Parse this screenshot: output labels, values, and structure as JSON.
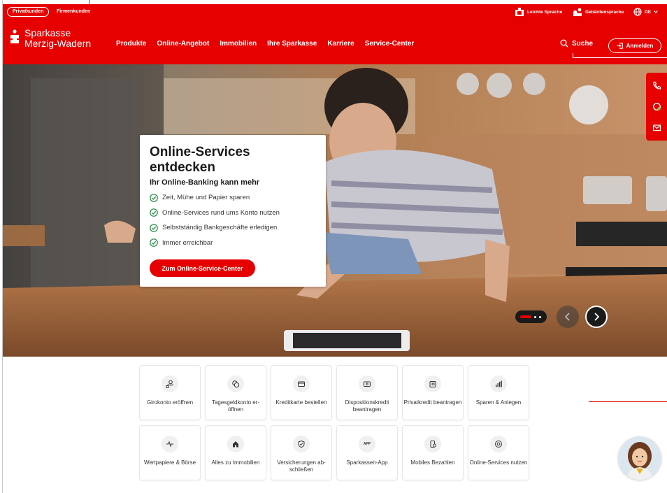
{
  "header": {
    "segment_private": "Privatkunden",
    "segment_business": "Firmenkunden",
    "easy_language": "Leichte Sprache",
    "sign_language": "Gebärdensprache",
    "language": "DE",
    "bank_name_line1": "Sparkasse",
    "bank_name_line2": "Merzig-Wadern",
    "nav": [
      "Produkte",
      "Online-Angebot",
      "Immobilien",
      "Ihre Sparkasse",
      "Karriere",
      "Service-Center"
    ],
    "search_label": "Suche",
    "login_label": "Anmelden"
  },
  "hero": {
    "title": "Online-Services entdecken",
    "subtitle": "Ihr Online-Banking kann mehr",
    "bullets": [
      "Zeit, Mühe und Papier sparen",
      "Online-Services rund ums Konto nutzen",
      "Selbstständig Bankgeschäfte erledigen",
      "Immer erreichbar"
    ],
    "cta": "Zum Online-Service-Center"
  },
  "tiles": [
    {
      "label": "Girokonto eröffnen",
      "icon": "hand-coin-icon"
    },
    {
      "label": "Tagesgeldkonto er­öffnen",
      "icon": "coins-icon"
    },
    {
      "label": "Kreditkarte bestel­len",
      "icon": "credit-card-icon"
    },
    {
      "label": "Dispositionskredit beantragen",
      "icon": "banknote-icon"
    },
    {
      "label": "Privatkredit bean­tragen",
      "icon": "wallet-icon"
    },
    {
      "label": "Sparen & Anlegen",
      "icon": "bar-chart-icon"
    },
    {
      "label": "Wertpapiere & Bör­se",
      "icon": "stock-pulse-icon"
    },
    {
      "label": "Alles zu Immobili­en",
      "icon": "house-icon"
    },
    {
      "label": "Versicherungen ab­schließen",
      "icon": "shield-icon"
    },
    {
      "label": "Sparkassen-App",
      "icon": "app-icon"
    },
    {
      "label": "Mobiles Bezahlen",
      "icon": "phone-pay-icon"
    },
    {
      "label": "Online-Services nutzen",
      "icon": "at-sign-icon"
    }
  ],
  "tile_app_glyph": "APP",
  "colors": {
    "brand": "#e60000",
    "dark": "#1a1a1a",
    "check": "#1e8a3a"
  }
}
